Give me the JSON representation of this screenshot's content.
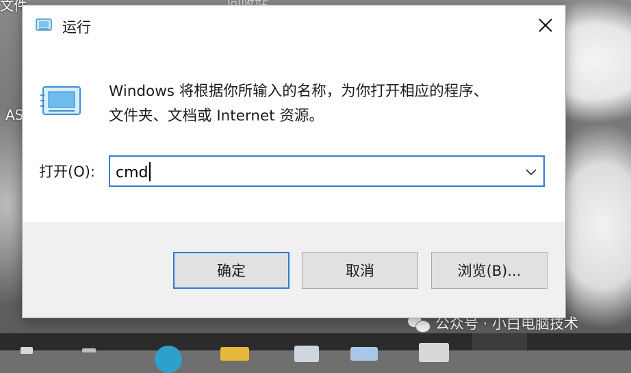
{
  "desktop": {
    "top_left_text": "文件",
    "top_mid_text": "回收站",
    "left_text": "AS"
  },
  "watermark": {
    "text": "公众号 · 小白电脑技术"
  },
  "dialog": {
    "title": "运行",
    "description_line1": "Windows 将根据你所输入的名称，为你打开相应的程序、",
    "description_line2": "文件夹、文档或 Internet 资源。",
    "open_label": "打开(O):",
    "open_value": "cmd",
    "buttons": {
      "ok": "确定",
      "cancel": "取消",
      "browse": "浏览(B)..."
    }
  },
  "colors": {
    "accent": "#2f7bd4",
    "button_bg": "#e1e1e1",
    "footer_bg": "#f0f0f0"
  }
}
